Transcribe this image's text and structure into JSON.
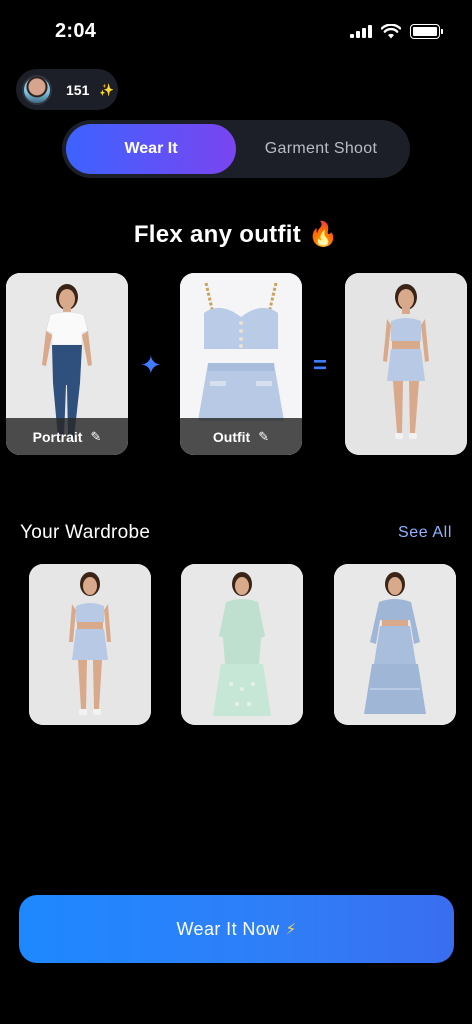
{
  "status": {
    "time": "2:04"
  },
  "credits": {
    "count": "151",
    "icon": "sparkle-icon"
  },
  "tabs": [
    {
      "label": "Wear It",
      "active": true
    },
    {
      "label": "Garment Shoot",
      "active": false
    }
  ],
  "headline": "Flex any outfit 🔥",
  "equation": {
    "portrait_label": "Portrait",
    "outfit_label": "Outfit",
    "plus_icon": "sparkles-icon",
    "equals_icon": "equals-icon"
  },
  "wardrobe": {
    "title": "Your Wardrobe",
    "see_all": "See All"
  },
  "cta": {
    "label": "Wear It Now",
    "icon": "⚡"
  },
  "colors": {
    "accent_blue": "#1e88ff",
    "tab_gradient_start": "#3d63ff",
    "tab_gradient_end": "#7a45f0",
    "link": "#8fb4ff"
  }
}
